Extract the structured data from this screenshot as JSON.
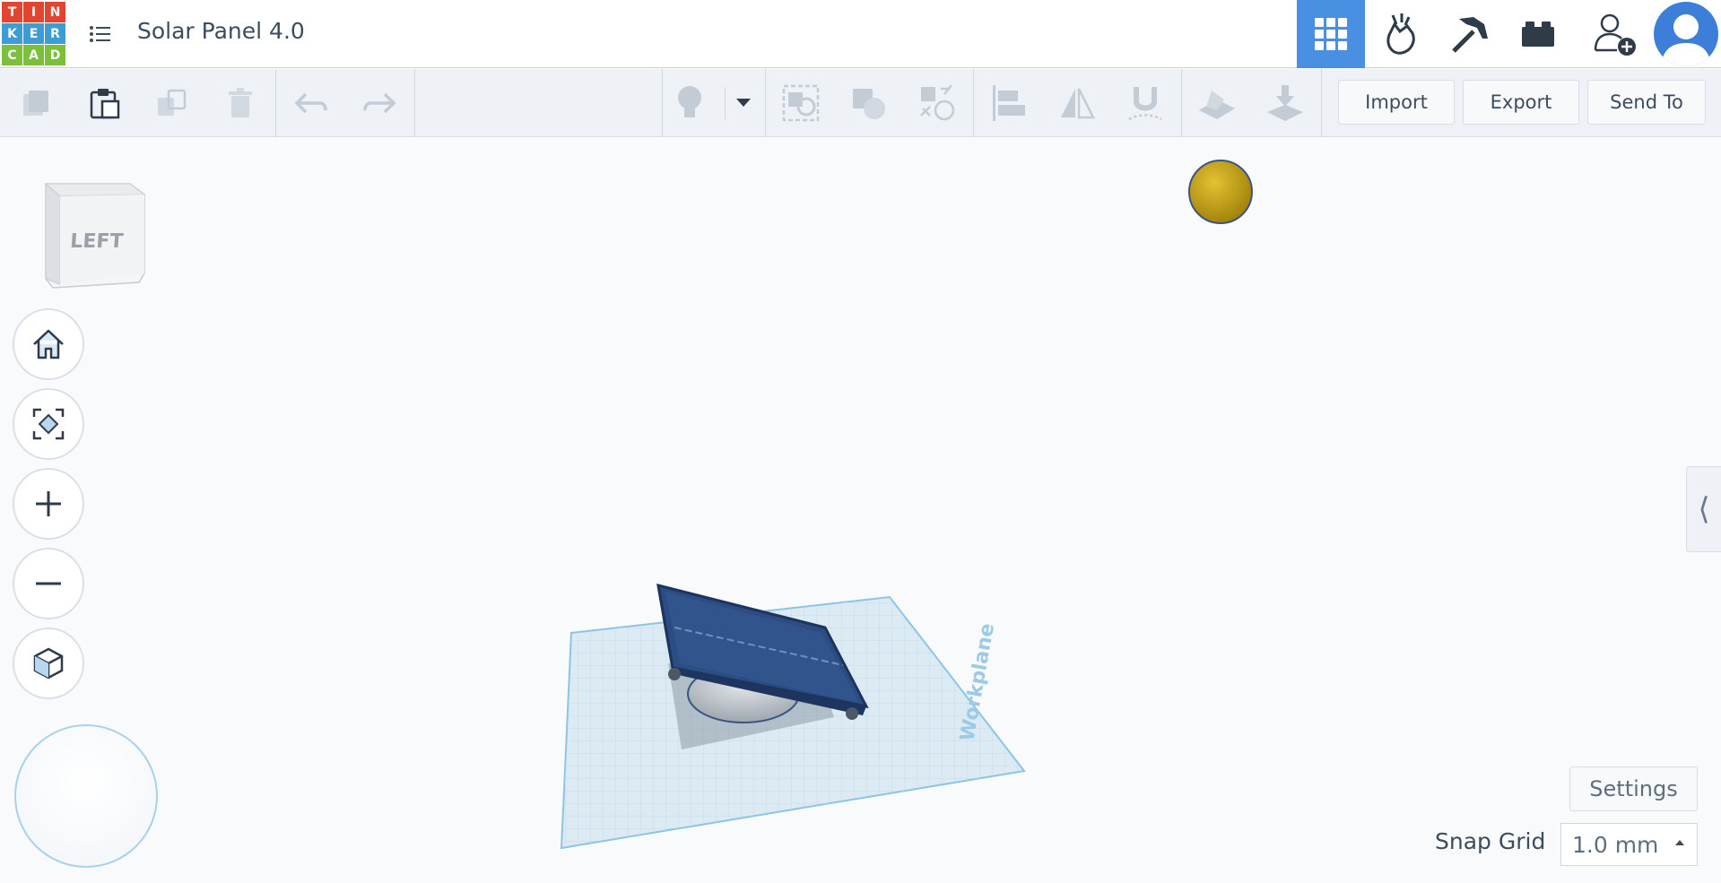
{
  "app": {
    "logo_letters": [
      "T",
      "I",
      "N",
      "K",
      "E",
      "R",
      "C",
      "A",
      "D"
    ],
    "logo_colors": [
      "#e2452f",
      "#e2452f",
      "#e2452f",
      "#3d9bd6",
      "#3d9bd6",
      "#3d9bd6",
      "#7cbf3a",
      "#7cbf3a",
      "#7cbf3a"
    ],
    "document_title": "Solar Panel 4.0"
  },
  "topnav": {
    "items": [
      {
        "name": "3d-design-grid-icon",
        "active": true
      },
      {
        "name": "circuits-icon",
        "active": false
      },
      {
        "name": "minecraft-pickaxe-icon",
        "active": false
      },
      {
        "name": "bricks-icon",
        "active": false
      },
      {
        "name": "invite-user-icon",
        "active": false
      }
    ]
  },
  "toolbar": {
    "import_label": "Import",
    "export_label": "Export",
    "send_to_label": "Send To"
  },
  "viewcube": {
    "face_label": "LEFT"
  },
  "workplane": {
    "label": "Workplane"
  },
  "settings": {
    "label": "Settings"
  },
  "snap_grid": {
    "label": "Snap Grid",
    "value": "1.0 mm"
  },
  "colors": {
    "accent": "#4a90e2",
    "panel": "#2d4a7a",
    "sun": "#c9a417",
    "workplane": "#dbeaf3"
  }
}
